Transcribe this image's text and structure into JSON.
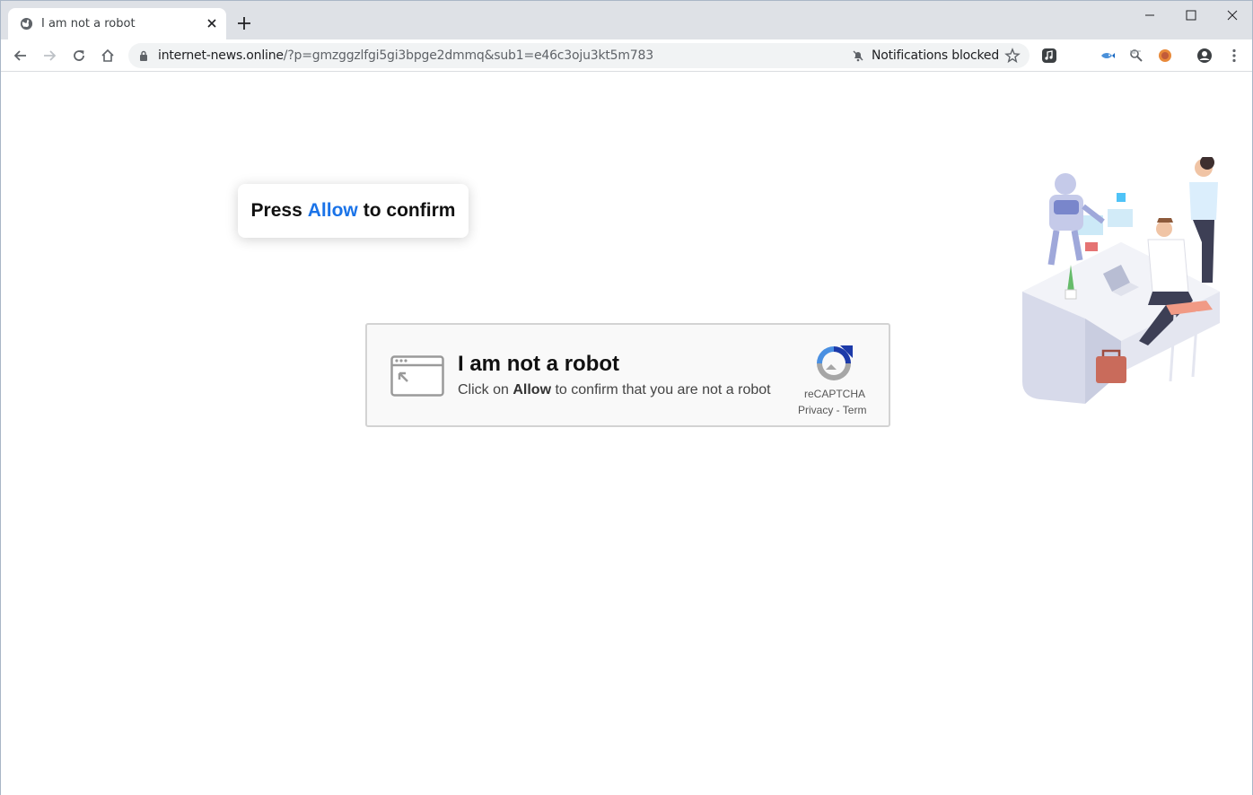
{
  "browser": {
    "tab_title": "I am not a robot",
    "url_host": "internet-news.online",
    "url_path": "/?p=gmzggzlfgi5gi3bpge2dmmq&sub1=e46c3oju3kt5m783",
    "notifications_label": "Notifications blocked"
  },
  "page": {
    "press_prefix": "Press",
    "press_allow": "Allow",
    "press_suffix": "to confirm",
    "captcha": {
      "title": "I am not a robot",
      "sub_prefix": "Click on",
      "sub_allow": "Allow",
      "sub_suffix": "to confirm that you are not a robot",
      "brand": "reCAPTCHA",
      "links": "Privacy - Term"
    }
  },
  "colors": {
    "accent_blue": "#1a73e8",
    "tabstrip": "#dee1e6"
  },
  "icons": [
    "globe-icon",
    "close-icon",
    "plus-icon",
    "minimize-icon",
    "maximize-icon",
    "back-icon",
    "forward-icon",
    "reload-icon",
    "home-icon",
    "lock-icon",
    "bell-off-icon",
    "star-icon",
    "music-extension-icon",
    "extension-icon",
    "profile-icon",
    "menu-icon",
    "recaptcha-logo-icon",
    "browser-window-icon"
  ]
}
